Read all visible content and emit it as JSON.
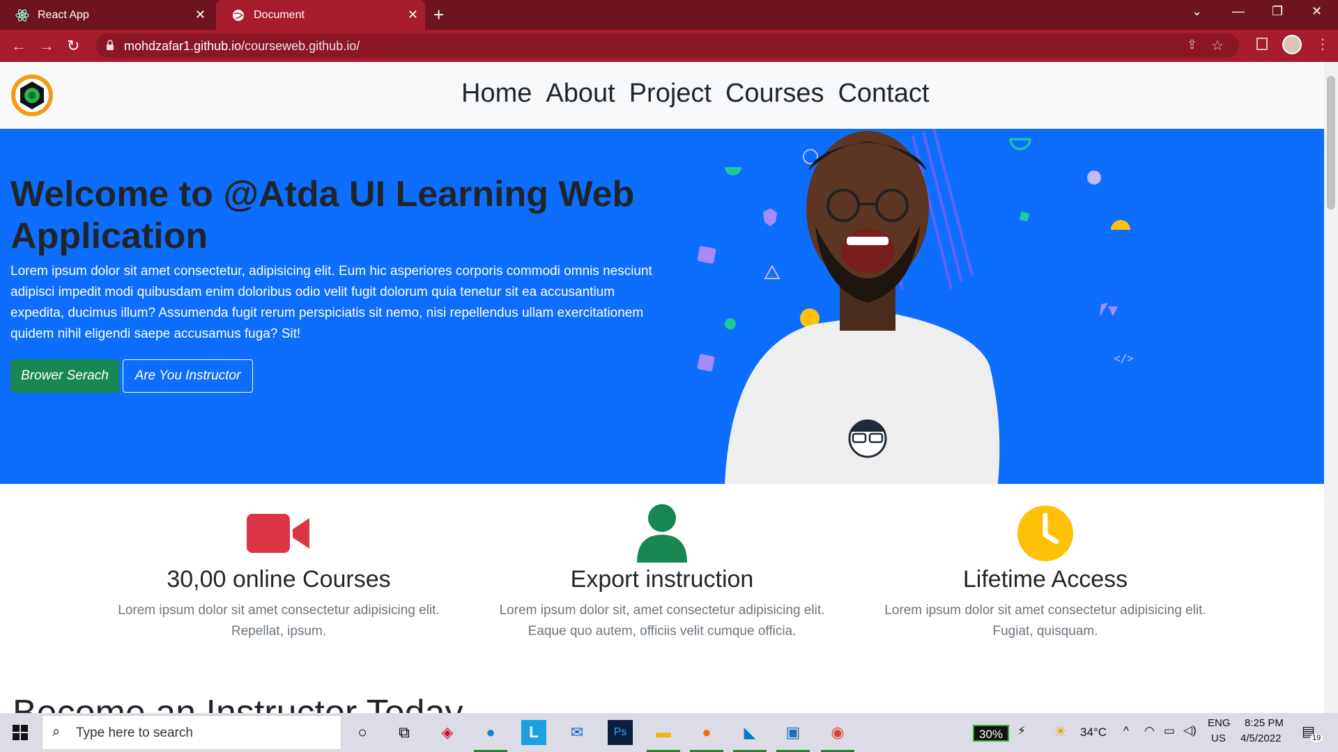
{
  "browser": {
    "tabs": [
      {
        "title": "React App",
        "active": false
      },
      {
        "title": "Document",
        "active": true
      }
    ],
    "url_host": "mohdzafar1.github.io",
    "url_path": "/courseweb.github.io/"
  },
  "site": {
    "nav": [
      "Home",
      "About",
      "Project",
      "Courses",
      "Contact"
    ],
    "hero": {
      "title": "Welcome to @Atda UI Learning Web Application",
      "text": "Lorem ipsum dolor sit amet consectetur, adipisicing elit. Eum hic asperiores corporis commodi omnis nesciunt adipisci impedit modi quibusdam enim doloribus odio velit fugit dolorum quia tenetur sit ea accusantium expedita, ducimus illum? Assumenda fugit rerum perspiciatis sit nemo, nisi repellendus ullam exercitationem quidem nihil eligendi saepe accusamus fuga? Sit!",
      "btn_primary": "Brower Serach",
      "btn_secondary": "Are You Instructor"
    },
    "features": [
      {
        "icon": "video-camera-icon",
        "color": "#dc3545",
        "title": "30,00 online Courses",
        "text": "Lorem ipsum dolor sit amet consectetur adipisicing elit. Repellat, ipsum."
      },
      {
        "icon": "person-icon",
        "color": "#198754",
        "title": "Export instruction",
        "text": "Lorem ipsum dolor sit, amet consectetur adipisicing elit. Eaque quo autem, officiis velit cumque officia."
      },
      {
        "icon": "clock-icon",
        "color": "#ffc107",
        "title": "Lifetime Access",
        "text": "Lorem ipsum dolor sit amet consectetur adipisicing elit. Fugiat, quisquam."
      }
    ],
    "next_heading": "Become an Instructor Today"
  },
  "taskbar": {
    "search_placeholder": "Type here to search",
    "battery": "30%",
    "weather": "34°C",
    "lang": "ENG",
    "region": "US",
    "time": "8:25 PM",
    "date": "4/5/2022",
    "notifications": "19"
  },
  "colors": {
    "hero_bg": "#0d6efd",
    "chrome": "#a61c2b",
    "tabstrip": "#6e1420"
  }
}
